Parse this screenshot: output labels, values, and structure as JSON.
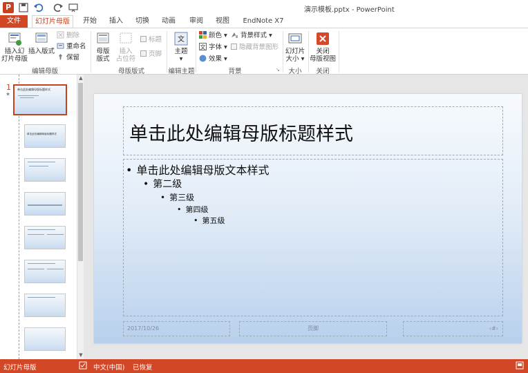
{
  "app": {
    "logo_letter": "P",
    "window_title": "演示模板.pptx - PowerPoint",
    "accent": "#d24726"
  },
  "qat": [
    "save-icon",
    "undo-icon",
    "redo-icon",
    "present-from-start-icon"
  ],
  "tabs": {
    "file": "文件",
    "items": [
      {
        "label": "幻灯片母版",
        "active": true
      },
      {
        "label": "开始"
      },
      {
        "label": "插入"
      },
      {
        "label": "切换"
      },
      {
        "label": "动画"
      },
      {
        "label": "审阅"
      },
      {
        "label": "视图"
      },
      {
        "label": "EndNote X7"
      }
    ]
  },
  "ribbon": {
    "edit_master": {
      "label": "编辑母版",
      "insert_master_l1": "插入幻",
      "insert_master_l2": "灯片母版",
      "insert_layout": "插入版式",
      "delete": "删除",
      "rename": "重命名",
      "preserve": "保留"
    },
    "master_layout": {
      "label": "母版版式",
      "master_layout_l1": "母版",
      "master_layout_l2": "版式",
      "insert_placeholder_l1": "插入",
      "insert_placeholder_l2": "占位符",
      "title_check": "标题",
      "footer_check": "页脚"
    },
    "edit_theme": {
      "label": "编辑主题",
      "theme": "主题"
    },
    "background": {
      "label": "背景",
      "colors": "颜色",
      "fonts": "字体",
      "effects": "效果",
      "bg_styles": "背景样式",
      "hide_bg": "隐藏背景图形"
    },
    "size": {
      "label": "大小",
      "slide_size_l1": "幻灯片",
      "slide_size_l2": "大小"
    },
    "close": {
      "label": "关闭",
      "close_l1": "关闭",
      "close_l2": "母版视图"
    }
  },
  "thumbs": {
    "master_number": "1",
    "master_mark": "*",
    "master_title_text": "单击此处编辑母版标题样式",
    "layout_title_text": "单击此处编辑母版标题样式"
  },
  "slide": {
    "title": "单击此处编辑母版标题样式",
    "levels": [
      "单击此处编辑母版文本样式",
      "第二级",
      "第三级",
      "第四级",
      "第五级"
    ],
    "date": "2017/10/26",
    "footer": "页脚",
    "number": "‹#›"
  },
  "status": {
    "view": "幻灯片母版",
    "language": "中文(中国)",
    "recovered": "已恢复"
  }
}
